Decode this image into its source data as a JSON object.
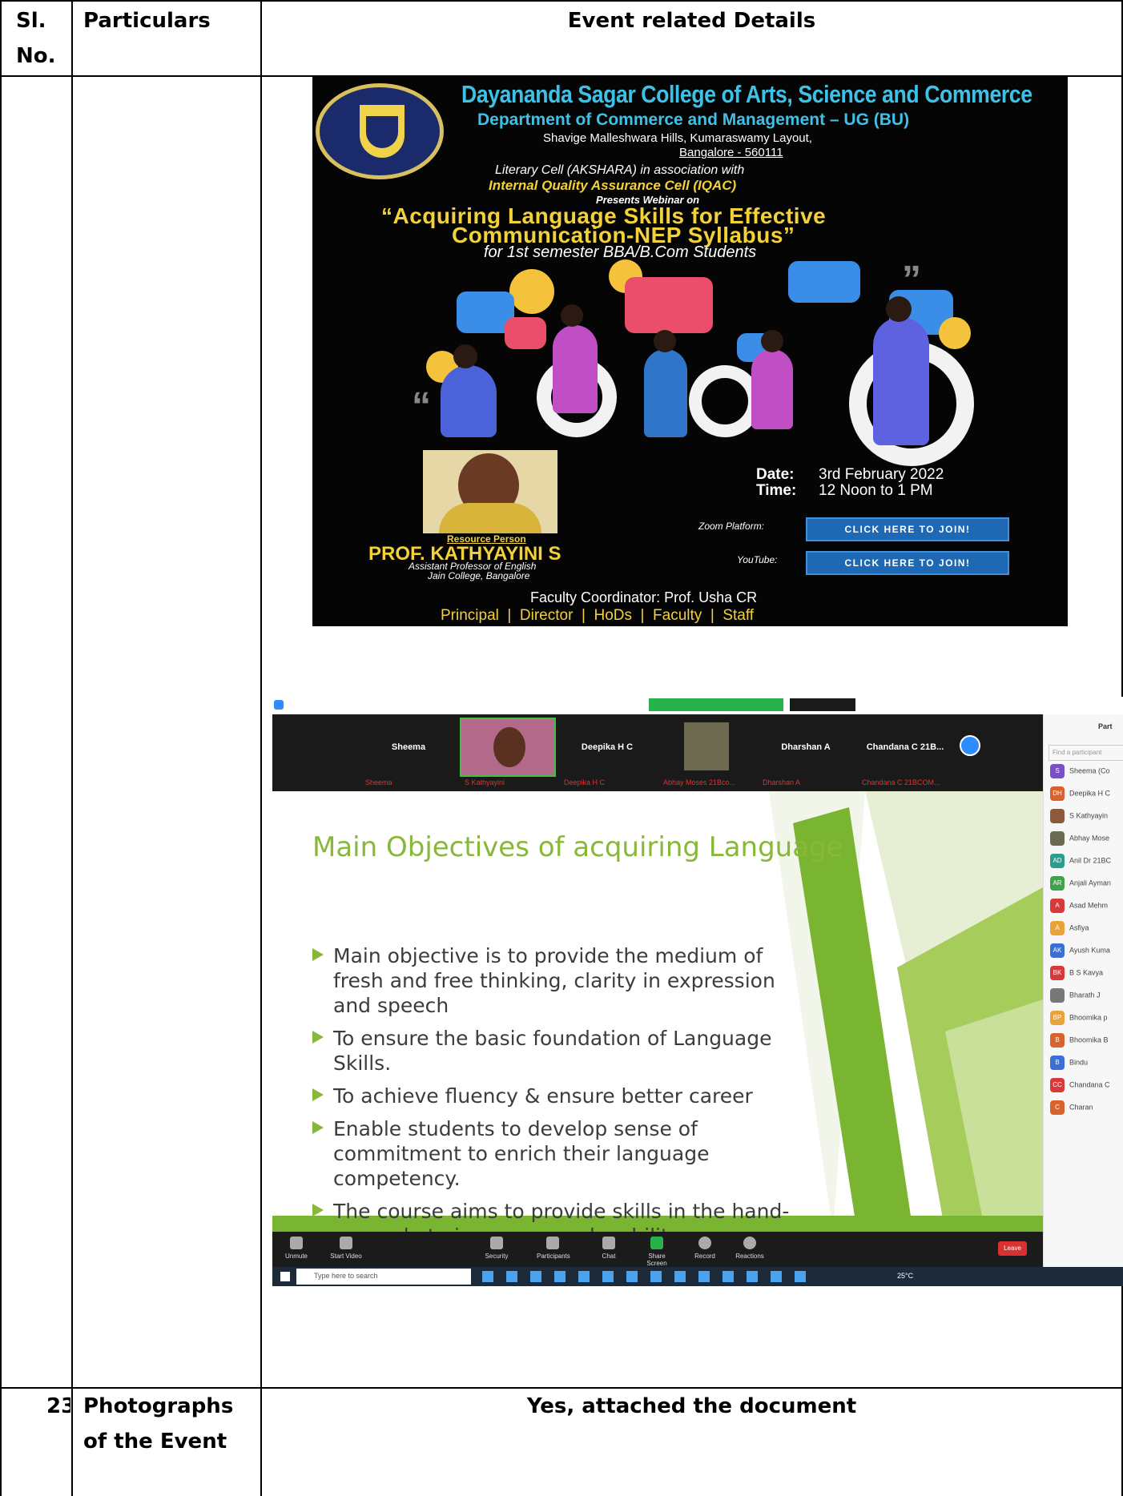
{
  "table": {
    "headers": {
      "sl_no": "Sl. No.",
      "particulars": "Particulars",
      "details": "Event related Details"
    },
    "last_row": {
      "sl_no": "23",
      "particulars": "Photographs of the Event",
      "details": "Yes, attached the document"
    }
  },
  "poster": {
    "college": "Dayananda Sagar College of Arts, Science and Commerce",
    "department": "Department of Commerce and Management – UG (BU)",
    "address1": "Shavige Malleshwara Hills, Kumaraswamy Layout,",
    "address2": "Bangalore - 560111",
    "cell": "Literary Cell (AKSHARA)  in association with",
    "iqac": "Internal Quality Assurance Cell (IQAC)",
    "presents": "Presents Webinar on",
    "title_line1": "“Acquiring Language Skills for Effective",
    "title_line2": "Communication-NEP Syllabus”",
    "audience": "for 1st semester BBA/B.Com Students",
    "date_label": "Date:",
    "date_value": "3rd February 2022",
    "time_label": "Time:",
    "time_value": "12 Noon to 1 PM",
    "resource_label": "Resource Person",
    "resource_name": "PROF. KATHYAYINI S",
    "resource_role": "Assistant Professor of English",
    "resource_college": "Jain College, Bangalore",
    "zoom_label": "Zoom Platform:",
    "youtube_label": "YouTube:",
    "join_button": "CLICK HERE TO JOIN!",
    "coordinator": "Faculty Coordinator: Prof. Usha CR",
    "footer": "Principal  |  Director  |  HoDs  |  Faculty  |  Staff",
    "colors": {
      "accent_yellow": "#f2d13a",
      "accent_blue": "#1f68b3",
      "title_cyan": "#3ec1e6"
    }
  },
  "zoom": {
    "participants_strip": [
      {
        "name": "Sheema",
        "sub": "Sheema"
      },
      {
        "name": "",
        "sub": "S Kathyayini"
      },
      {
        "name": "Deepika H C",
        "sub": "Deepika H C"
      },
      {
        "name": "",
        "sub": "Abhay Moses 21Bco..."
      },
      {
        "name": "Dharshan A",
        "sub": "Dharshan A"
      },
      {
        "name": "Chandana C 21B...",
        "sub": "Chandana C 21BCOM..."
      }
    ],
    "slide": {
      "title": "Main Objectives of acquiring Language",
      "bullets": [
        "Main objective is to provide the medium of fresh and free thinking, clarity in expression and speech",
        "To ensure the basic foundation of Language Skills.",
        "To achieve fluency & ensure better career",
        "Enable students to develop sense of commitment to enrich their language competency.",
        "The course aims to provide skills in the hand-on mode to increase employability."
      ]
    },
    "toolbar": [
      "Unmute",
      "Start Video",
      "Security",
      "Participants",
      "Chat",
      "Share Screen",
      "Record",
      "Reactions"
    ],
    "leave": "Leave",
    "search_placeholder": "Type here to search",
    "temperature": "25°C",
    "participants_panel_title": "Part",
    "panel_search": "Find a participant",
    "panel_items": [
      {
        "initials": "S",
        "color": "#7b4fc7",
        "name": "Sheema (Co"
      },
      {
        "initials": "DH",
        "color": "#d9632c",
        "name": "Deepika H C"
      },
      {
        "initials": "",
        "color": "#8a5a3a",
        "name": "S Kathyayin"
      },
      {
        "initials": "",
        "color": "#6a6a50",
        "name": "Abhay Mose"
      },
      {
        "initials": "AD",
        "color": "#2a9d8f",
        "name": "Anil Dr 21BC"
      },
      {
        "initials": "AR",
        "color": "#3fa34d",
        "name": "Anjali Ayman"
      },
      {
        "initials": "A",
        "color": "#d63a3a",
        "name": "Asad Mehm"
      },
      {
        "initials": "A",
        "color": "#e8a33a",
        "name": "Asfiya"
      },
      {
        "initials": "AK",
        "color": "#3a6fd6",
        "name": "Ayush Kuma"
      },
      {
        "initials": "BK",
        "color": "#d63a3a",
        "name": "B S Kavya"
      },
      {
        "initials": "",
        "color": "#777777",
        "name": "Bharath J"
      },
      {
        "initials": "BP",
        "color": "#e8a33a",
        "name": "Bhoomika p"
      },
      {
        "initials": "B",
        "color": "#d9632c",
        "name": "Bhoomika B"
      },
      {
        "initials": "B",
        "color": "#3a6fd6",
        "name": "Bindu"
      },
      {
        "initials": "CC",
        "color": "#d63a3a",
        "name": "Chandana C"
      },
      {
        "initials": "C",
        "color": "#d9632c",
        "name": "Charan"
      }
    ]
  }
}
